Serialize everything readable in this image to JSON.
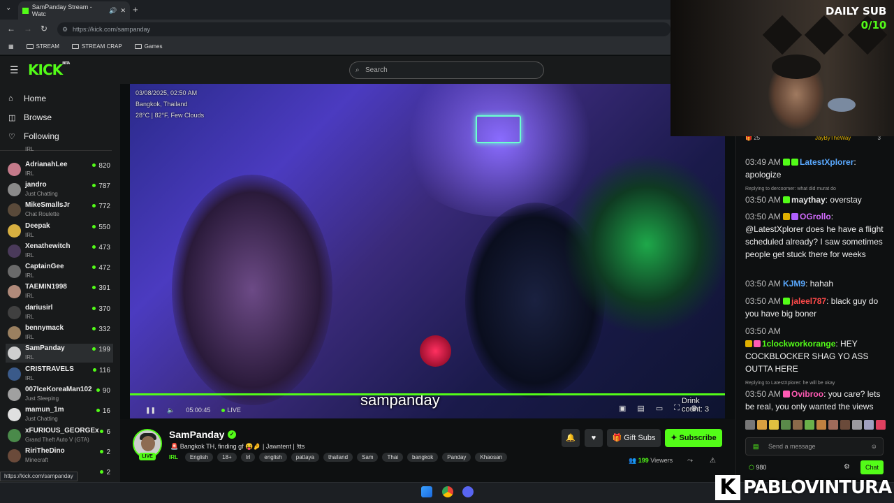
{
  "browser": {
    "tab_title": "SamPanday Stream - Watc",
    "url": "https://kick.com/sampanday",
    "bookmarks": [
      "STREAM",
      "STREAM CRAP",
      "Games"
    ],
    "status_url": "https://kick.com/sampanday"
  },
  "header": {
    "logo": "KICK",
    "beta": "BETA",
    "search_placeholder": "Search"
  },
  "nav": {
    "home": "Home",
    "browse": "Browse",
    "following": "Following"
  },
  "channels": [
    {
      "name": "",
      "category": "IRL",
      "viewers": ""
    },
    {
      "name": "AdrianahLee",
      "category": "IRL",
      "viewers": "820"
    },
    {
      "name": "jandro",
      "category": "Just Chatting",
      "viewers": "787"
    },
    {
      "name": "MikeSmallsJr",
      "category": "Chat Roulette",
      "viewers": "772"
    },
    {
      "name": "Deepak",
      "category": "IRL",
      "viewers": "550"
    },
    {
      "name": "Xenathewitch",
      "category": "IRL",
      "viewers": "473"
    },
    {
      "name": "CaptainGee",
      "category": "IRL",
      "viewers": "472"
    },
    {
      "name": "TAEMIN1998",
      "category": "IRL",
      "viewers": "391"
    },
    {
      "name": "dariusirl",
      "category": "IRL",
      "viewers": "370"
    },
    {
      "name": "bennymack",
      "category": "IRL",
      "viewers": "332"
    },
    {
      "name": "SamPanday",
      "category": "IRL",
      "viewers": "199"
    },
    {
      "name": "CRISTRAVELS",
      "category": "IRL",
      "viewers": "116"
    },
    {
      "name": "007IceKoreaMan102",
      "category": "Just Sleeping",
      "viewers": "90"
    },
    {
      "name": "mamun_1m",
      "category": "Just Chatting",
      "viewers": "16"
    },
    {
      "name": "xFURIOUS_GEORGEx",
      "category": "Grand Theft Auto V (GTA)",
      "viewers": "6"
    },
    {
      "name": "RiriTheDino",
      "category": "Minecraft",
      "viewers": "2"
    },
    {
      "name": "",
      "category": "",
      "viewers": "2"
    }
  ],
  "video": {
    "overlay_date": "03/08/2025, 02:50 AM",
    "overlay_location": "Bangkok, Thailand",
    "overlay_weather": "28°C | 82°F, Few Clouds",
    "watermark": "sampanday",
    "corner_text_1": "Drink",
    "corner_text_2": "count: 3",
    "time": "05:00:45",
    "live": "LIVE",
    "progress": 1.0
  },
  "stream": {
    "name": "SamPanday",
    "live_badge": "LIVE",
    "title": "🚨 Bangkok TH, finding gf 😝🤌 | Jawntent | !tts",
    "category": "IRL",
    "tags": [
      "English",
      "18+",
      "Irl",
      "english",
      "pattaya",
      "thailand",
      "Sam",
      "Thai",
      "bangkok",
      "Panday",
      "Khaosan"
    ],
    "viewers": "199",
    "viewers_label": "Viewers",
    "gift_subs": "Gift Subs",
    "subscribe": "Subscribe"
  },
  "chat": {
    "top_count": "25",
    "top_user": "JayByTheWay",
    "top_user_count": "3",
    "messages": [
      {
        "reply": "",
        "time": "03:49 AM",
        "user": "LatestXplorer",
        "color": "#5aa9ff",
        "text": "apologize"
      },
      {
        "reply": "Replying to dercoomer: what did murat do",
        "time": "03:50 AM",
        "user": "maythay",
        "color": "#e8e8e8",
        "text": "overstay"
      },
      {
        "reply": "",
        "time": "03:50 AM",
        "user": "OGrollo",
        "color": "#d36cff",
        "text": "@LatestXplorer does he have a flight scheduled already? I saw sometimes people get stuck there for weeks"
      },
      {
        "reply": "",
        "time": "03:50 AM",
        "user": "KJM9",
        "color": "#5aa9ff",
        "text": "hahah"
      },
      {
        "reply": "",
        "time": "03:50 AM",
        "user": "jaleel787",
        "color": "#ff4a4a",
        "text": "black guy do you have big boner"
      },
      {
        "reply": "",
        "time": "03:50 AM",
        "user": "1clockworkorange",
        "color": "#53fc18",
        "text": "HEY COCKBLOCKER SHAG YO ASS OUTTA HERE"
      },
      {
        "reply": "Replying to LatestXplorer: he will be okay",
        "time": "03:50 AM",
        "user": "Ovibroo",
        "color": "#ff5ab4",
        "text": "you care? lets be real, you only wanted the views"
      }
    ],
    "input_placeholder": "Send a message",
    "points": "980",
    "chat_button": "Chat"
  },
  "overlay": {
    "daily_sub_label": "DAILY SUB",
    "daily_sub_count": "0/10",
    "brand_k": "K",
    "brand_name": "PABLOVINTURA"
  },
  "colors": {
    "accent": "#53fc18"
  }
}
